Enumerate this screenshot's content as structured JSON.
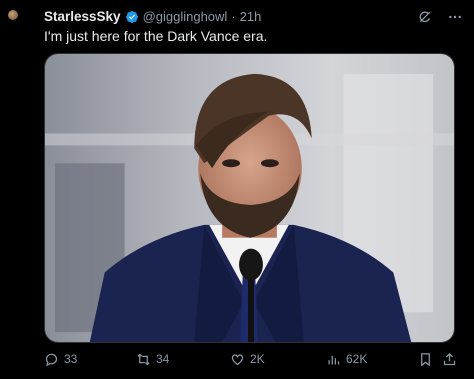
{
  "tweet": {
    "display_name": "StarlessSky",
    "handle": "@gigglinghowl",
    "separator": "·",
    "time": "21h",
    "text": "I'm just here for the Dark Vance era."
  },
  "actions": {
    "replies": "33",
    "retweets": "34",
    "likes": "2K",
    "views": "62K"
  },
  "icons": {
    "verified": "verified-badge-icon",
    "grok": "grok-icon",
    "more": "more-icon",
    "reply": "reply-icon",
    "retweet": "retweet-icon",
    "like": "heart-icon",
    "views": "views-icon",
    "bookmark": "bookmark-icon",
    "share": "share-icon"
  },
  "colors": {
    "background": "#000000",
    "text": "#e7e9ea",
    "secondary": "#8b98a5",
    "verified": "#1d9bf0"
  }
}
